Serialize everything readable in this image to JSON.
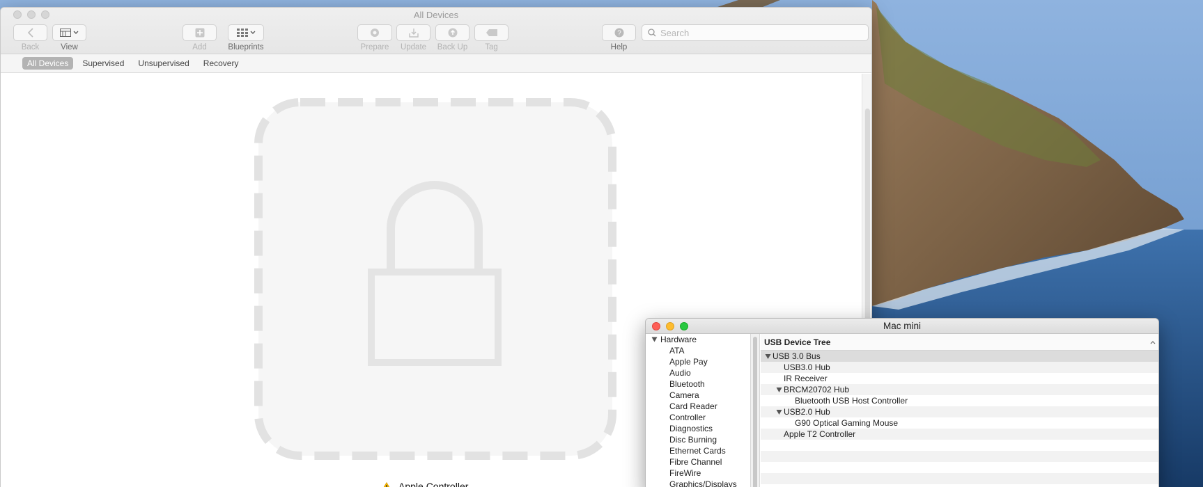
{
  "configurator": {
    "title": "All Devices",
    "toolbar": {
      "back": "Back",
      "view": "View",
      "add": "Add",
      "blueprints": "Blueprints",
      "prepare": "Prepare",
      "update": "Update",
      "back_up": "Back Up",
      "tag": "Tag",
      "help": "Help",
      "search_placeholder": "Search"
    },
    "scopes": [
      "All Devices",
      "Supervised",
      "Unsupervised",
      "Recovery"
    ],
    "active_scope": "All Devices",
    "device": {
      "name": "Apple Controller",
      "status_icon": "warning-icon",
      "placeholder_icon": "lock-icon"
    }
  },
  "system_info": {
    "title": "Mac mini",
    "sidebar": {
      "section": "Hardware",
      "items": [
        "ATA",
        "Apple Pay",
        "Audio",
        "Bluetooth",
        "Camera",
        "Card Reader",
        "Controller",
        "Diagnostics",
        "Disc Burning",
        "Ethernet Cards",
        "Fibre Channel",
        "FireWire",
        "Graphics/Displays"
      ]
    },
    "tree": {
      "header": "USB Device Tree",
      "rows": [
        {
          "label": "USB 3.0 Bus",
          "level": 0,
          "expanded": true
        },
        {
          "label": "USB3.0 Hub",
          "level": 1
        },
        {
          "label": "IR Receiver",
          "level": 1
        },
        {
          "label": "BRCM20702 Hub",
          "level": 1,
          "expanded": true
        },
        {
          "label": "Bluetooth USB Host Controller",
          "level": 2
        },
        {
          "label": "USB2.0 Hub",
          "level": 1,
          "expanded": true
        },
        {
          "label": "G90 Optical Gaming Mouse",
          "level": 2
        },
        {
          "label": "Apple T2 Controller",
          "level": 1
        }
      ]
    }
  },
  "colors": {
    "close": "#fe5f57",
    "minimize": "#febc2e",
    "zoom": "#28c840",
    "scope_active_bg": "#b3b3b3",
    "warning": "#f5b400"
  }
}
